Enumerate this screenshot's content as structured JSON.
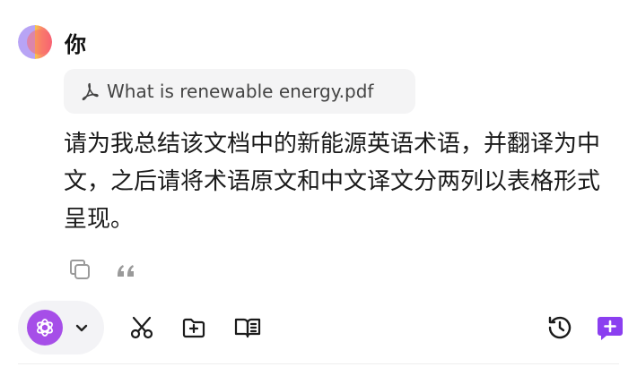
{
  "user": {
    "name": "你",
    "avatar_icon": "gradient-avatar"
  },
  "attachment": {
    "filename": "What is renewable energy.pdf",
    "icon": "pdf-icon"
  },
  "message": {
    "text": "请为我总结该文档中的新能源英语术语，并翻译为中文，之后请将术语原文和中文译文分两列以表格形式呈现。"
  },
  "message_actions": [
    {
      "name": "copy-icon"
    },
    {
      "name": "quote-icon"
    }
  ],
  "toolbar": {
    "model_logo": "openai-logo-icon",
    "accent_color": "#a64ee8",
    "new_chat_color": "#8b3ff0",
    "tools": [
      "scissors-icon",
      "add-folder-icon",
      "book-icon",
      "history-icon",
      "new-chat-icon"
    ]
  }
}
